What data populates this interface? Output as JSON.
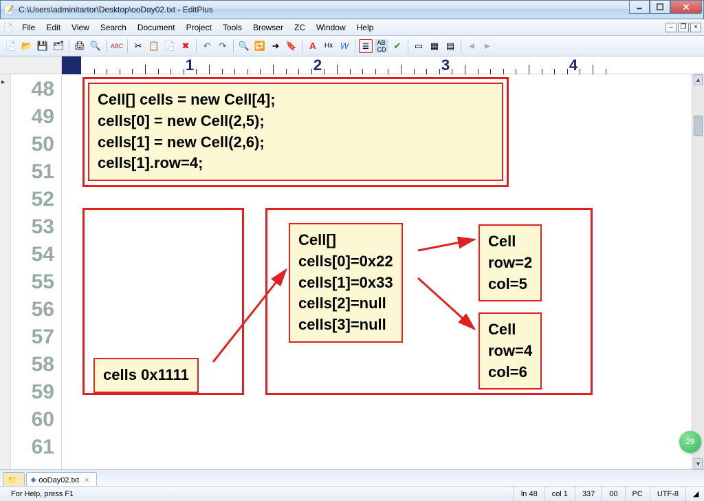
{
  "title": "C:\\Users\\adminitartor\\Desktop\\ooDay02.txt - EditPlus",
  "menu": [
    "File",
    "Edit",
    "View",
    "Search",
    "Document",
    "Project",
    "Tools",
    "Browser",
    "ZC",
    "Window",
    "Help"
  ],
  "ruler_numbers": [
    "1",
    "2",
    "3",
    "4"
  ],
  "line_numbers": [
    "48",
    "49",
    "50",
    "51",
    "52",
    "53",
    "54",
    "55",
    "56",
    "57",
    "58",
    "59",
    "60",
    "61"
  ],
  "code_box": "Cell[] cells = new Cell[4];\ncells[0] = new Cell(2,5);\ncells[1] = new Cell(2,6);\ncells[1].row=4;",
  "stack_box": "cells 0x1111",
  "array_box": "Cell[]\ncells[0]=0x22\ncells[1]=0x33\ncells[2]=null\ncells[3]=null",
  "cell_a": "Cell\nrow=2\ncol=5",
  "cell_b": "Cell\nrow=4\ncol=6",
  "tab_name": "ooDay02.txt",
  "status": {
    "help": "For Help, press F1",
    "ln": "ln 48",
    "col": "col 1",
    "chars": "337",
    "sel": "00",
    "platform": "PC",
    "encoding": "UTF-8"
  },
  "greenball": "29"
}
